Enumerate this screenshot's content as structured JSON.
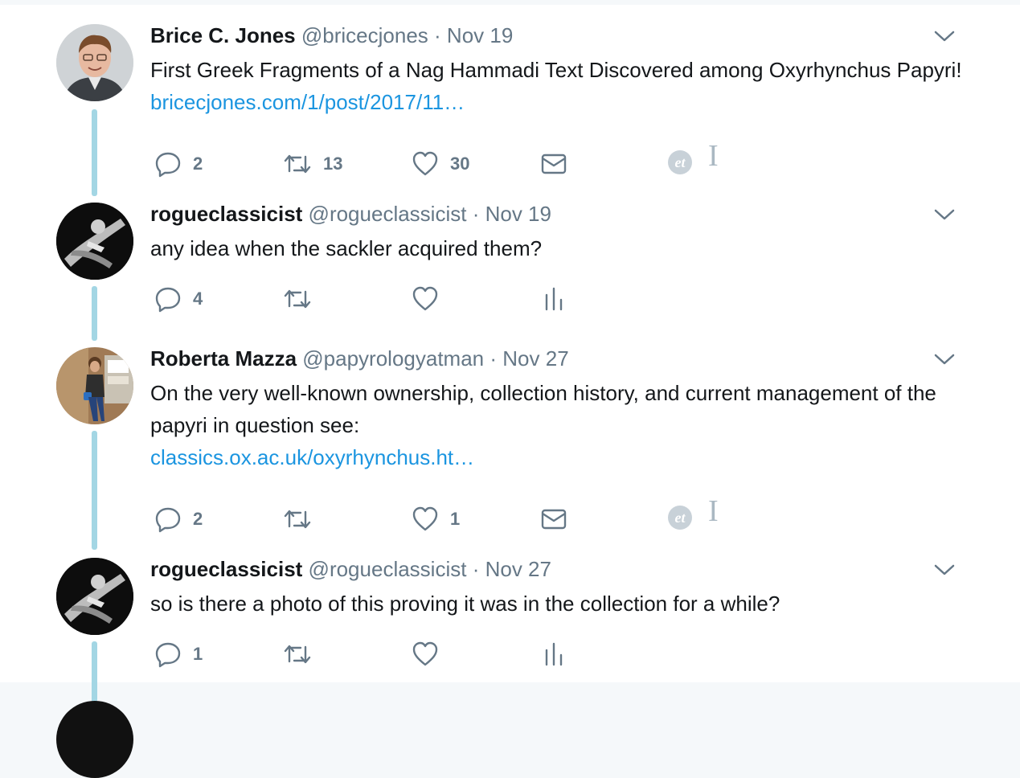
{
  "tweets": [
    {
      "name": "Brice C. Jones",
      "handle": "@bricecjones",
      "separator": "·",
      "date": "Nov 19",
      "text": "First Greek Fragments of a Nag Hammadi Text Discovered among Oxyrhynchus Papyri!",
      "link": "bricecjones.com/1/post/2017/11…",
      "replies": "2",
      "retweets": "13",
      "likes": "30"
    },
    {
      "name": "rogueclassicist",
      "handle": "@rogueclassicist",
      "separator": "·",
      "date": "Nov 19",
      "text": "any idea when the sackler acquired them?",
      "replies": "4",
      "retweets": "",
      "likes": ""
    },
    {
      "name": "Roberta Mazza",
      "handle": "@papyrologyatman",
      "separator": "·",
      "date": "Nov 27",
      "text": "On the very well-known ownership, collection history, and current management of the papyri in question see:",
      "link": "classics.ox.ac.uk/oxyrhynchus.ht…",
      "replies": "2",
      "retweets": "",
      "likes": "1"
    },
    {
      "name": "rogueclassicist",
      "handle": "@rogueclassicist",
      "separator": "·",
      "date": "Nov 27",
      "text": "so is there a photo of this proving it was in the collection for a while?",
      "replies": "1",
      "retweets": "",
      "likes": ""
    }
  ],
  "extensions": {
    "et_label": "et",
    "i_label": "I"
  },
  "icons": {
    "reply": "reply-icon",
    "retweet": "retweet-icon",
    "like": "heart-icon",
    "dm": "envelope-icon",
    "analytics": "analytics-icon",
    "caret": "chevron-down-icon"
  },
  "colors": {
    "text": "#14171a",
    "secondary": "#657786",
    "link": "#1b95e0",
    "thread_line": "#a3d6e4",
    "background": "#f5f8fa"
  }
}
